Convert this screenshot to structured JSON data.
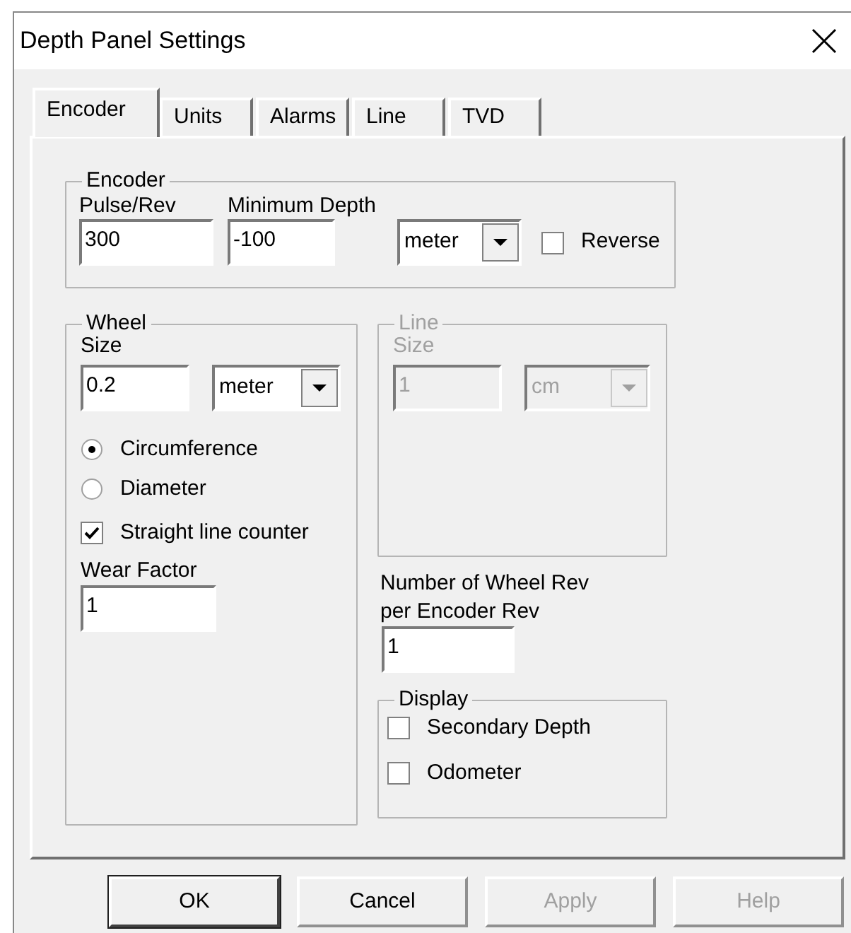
{
  "window": {
    "title": "Depth Panel Settings"
  },
  "tabs": [
    {
      "label": "Encoder",
      "selected": true
    },
    {
      "label": "Units",
      "selected": false
    },
    {
      "label": "Alarms",
      "selected": false
    },
    {
      "label": "Line",
      "selected": false
    },
    {
      "label": "TVD",
      "selected": false
    }
  ],
  "encoder_group": {
    "title": "Encoder",
    "pulse_rev": {
      "label": "Pulse/Rev",
      "value": "300"
    },
    "minimum_depth": {
      "label": "Minimum Depth",
      "value": "-100"
    },
    "unit": {
      "value": "meter"
    },
    "reverse": {
      "label": "Reverse",
      "checked": false
    }
  },
  "wheel_group": {
    "title": "Wheel",
    "size_label": "Size",
    "size": {
      "value": "0.2"
    },
    "unit": {
      "value": "meter"
    },
    "options": [
      {
        "label": "Circumference",
        "selected": true
      },
      {
        "label": "Diameter",
        "selected": false
      }
    ],
    "straight_line_counter": {
      "label": "Straight line counter",
      "checked": true
    },
    "wear_factor": {
      "label": "Wear Factor",
      "value": "1"
    }
  },
  "line_group": {
    "title": "Line",
    "disabled": true,
    "size_label": "Size",
    "size": {
      "value": "1"
    },
    "unit": {
      "value": "cm"
    }
  },
  "wheel_rev_per_encoder_rev": {
    "label": "Number of Wheel Rev per Encoder Rev",
    "value": "1"
  },
  "display_group": {
    "title": "Display",
    "options": [
      {
        "label": "Secondary Depth",
        "checked": false
      },
      {
        "label": "Odometer",
        "checked": false
      }
    ]
  },
  "buttons": [
    {
      "label": "OK",
      "disabled": false,
      "default": true
    },
    {
      "label": "Cancel",
      "disabled": false,
      "default": false
    },
    {
      "label": "Apply",
      "disabled": true,
      "default": false
    },
    {
      "label": "Help",
      "disabled": true,
      "default": false
    }
  ]
}
